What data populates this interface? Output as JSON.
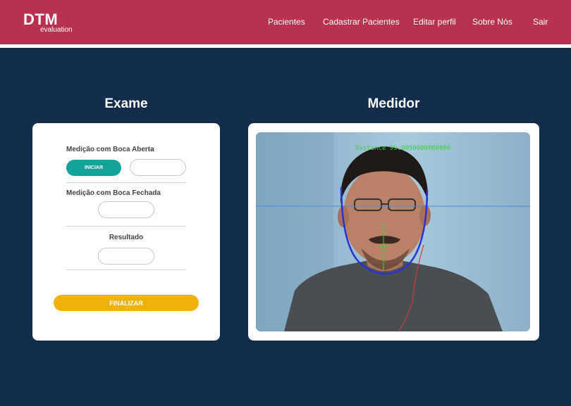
{
  "app": {
    "brand_title": "DTM",
    "brand_subtitle": "evaluation"
  },
  "nav": {
    "items": [
      "Pacientes",
      "Cadastrar Pacientes",
      "Editar perfil",
      "Sobre Nós",
      "Sair"
    ]
  },
  "exam": {
    "title": "Exame",
    "open_label": "Medição com Boca Aberta",
    "start_button": "INICIAR",
    "closed_label": "Medição com Boca Fechada",
    "result_label": "Resultado",
    "finish_button": "FINALIZAR",
    "open_value": "",
    "closed_value": "",
    "result_value": ""
  },
  "meter": {
    "title": "Medidor",
    "overlay_text": "Distance 99.0050000000000"
  },
  "colors": {
    "background": "#122d4a",
    "topbar": "#b8324f",
    "start_button": "#14a39a",
    "finish_button": "#f0b10b",
    "overlay_text": "#35d435",
    "jaw_curve": "#2a33d0",
    "guide_line": "#4a8fd8"
  }
}
